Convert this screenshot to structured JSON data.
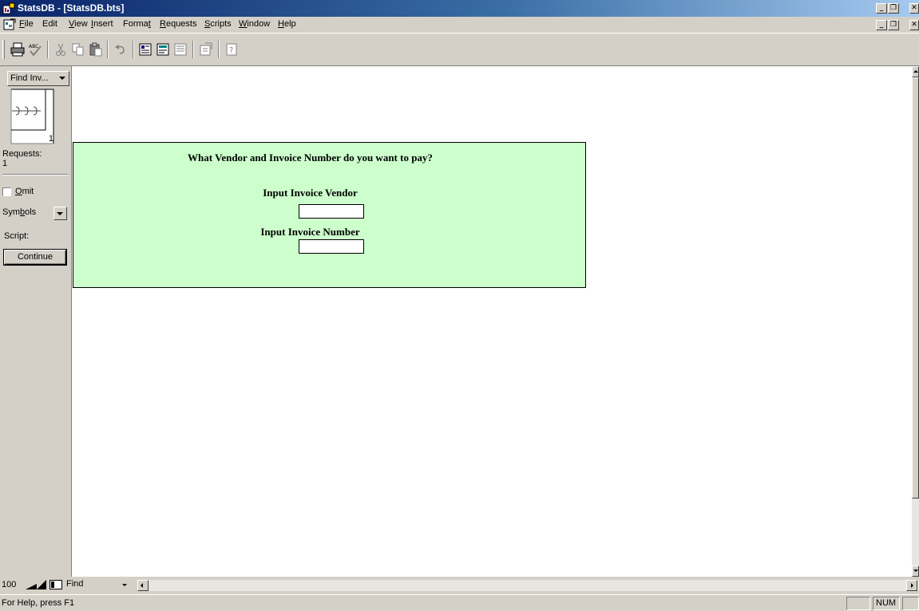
{
  "window": {
    "title": "StatsDB - [StatsDB.bts]"
  },
  "menu": {
    "items": [
      {
        "pre": "",
        "u": "F",
        "post": "ile"
      },
      {
        "pre": "",
        "u": "",
        "post": "Edit"
      },
      {
        "pre": "",
        "u": "V",
        "post": "iew"
      },
      {
        "pre": "",
        "u": "I",
        "post": "nsert"
      },
      {
        "pre": "Forma",
        "u": "t",
        "post": ""
      },
      {
        "pre": "",
        "u": "R",
        "post": "equests"
      },
      {
        "pre": "",
        "u": "S",
        "post": "cripts"
      },
      {
        "pre": "",
        "u": "W",
        "post": "indow"
      },
      {
        "pre": "",
        "u": "H",
        "post": "elp"
      }
    ]
  },
  "toolbar": {
    "icons": [
      "print-icon",
      "spellcheck-icon",
      "cut-icon",
      "copy-icon",
      "paste-icon",
      "undo-icon",
      "request-icon",
      "request-edit-icon",
      "request-run-icon",
      "properties-icon",
      "help-book-icon"
    ]
  },
  "sidebar": {
    "request_select": "Find Inv...",
    "page_number": "1",
    "requests_label": "Requests:",
    "requests_count": "1",
    "omit_label_u": "O",
    "omit_label_rest": "mit",
    "omit_checked": false,
    "symbols_pre": "Sym",
    "symbols_u": "b",
    "symbols_post": "ols",
    "script_label": "Script:",
    "continue_label": "Continue"
  },
  "form": {
    "question": "What Vendor and Invoice Number do you want to pay?",
    "vendor_label": "Input Invoice Vendor",
    "vendor_value": "",
    "number_label": "Input Invoice Number",
    "number_value": ""
  },
  "bottom": {
    "zoom": "100",
    "find_select": "Find"
  },
  "statusbar": {
    "help_text": "For Help, press F1",
    "num_indicator": "NUM"
  },
  "colors": {
    "form_background": "#ccffcc",
    "titlebar_active": "#0a246a"
  }
}
